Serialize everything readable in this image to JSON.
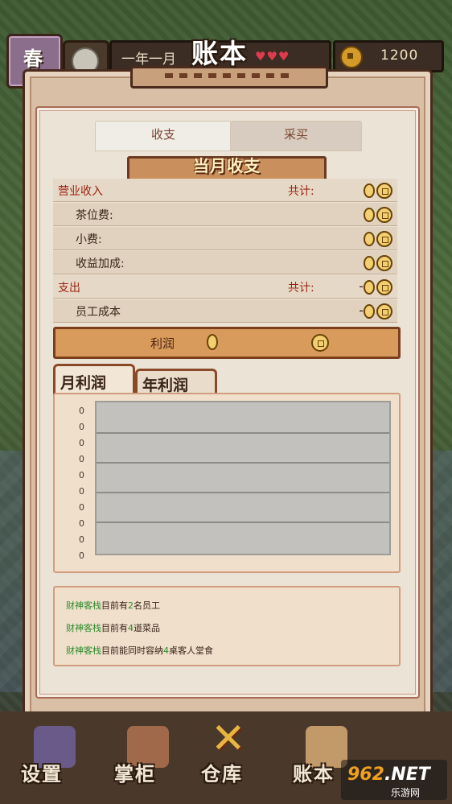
{
  "topbar": {
    "season": "春",
    "date": "一年一月",
    "hearts": "♥♥♥",
    "coins": "1200"
  },
  "page_title": "账本",
  "tabs": {
    "income": "收支",
    "purchase": "采买"
  },
  "section_title": "当月收支",
  "ledger": {
    "revenue_label": "营业收入",
    "revenue_total_label": "共计:",
    "revenue_total": "0",
    "tea_fee_label": "茶位费:",
    "tea_fee": "0",
    "tips_label": "小费:",
    "tips": "0",
    "bonus_label": "收益加成:",
    "bonus": "0",
    "expense_label": "支出",
    "expense_total_label": "共计:",
    "expense_total": "-0",
    "staff_cost_label": "员工成本",
    "staff_cost": "-0"
  },
  "profit": {
    "label": "利润",
    "value": "0"
  },
  "chart_tabs": {
    "month": "月利润",
    "year": "年利润"
  },
  "chart_data": {
    "type": "bar",
    "title": "",
    "xlabel": "",
    "ylabel": "",
    "y_ticks": [
      "0",
      "0",
      "0",
      "0",
      "0",
      "0",
      "0",
      "0",
      "0",
      "0"
    ],
    "categories": [],
    "values": []
  },
  "info": {
    "inn_name": "财神客栈",
    "line1_pre": "目前有",
    "line1_num": "2",
    "line1_post": "名员工",
    "line2_pre": "目前有",
    "line2_num": "4",
    "line2_post": "道菜品",
    "line3_pre": "目前能同时容纳",
    "line3_num": "4",
    "line3_post": "桌客人堂食"
  },
  "bottom_nav": {
    "settings": "设置",
    "manager": "掌柜",
    "warehouse": "仓库",
    "ledger": "账本"
  },
  "watermark": {
    "brand_a": "962",
    "brand_b": ".NET",
    "sub": "乐游网"
  }
}
